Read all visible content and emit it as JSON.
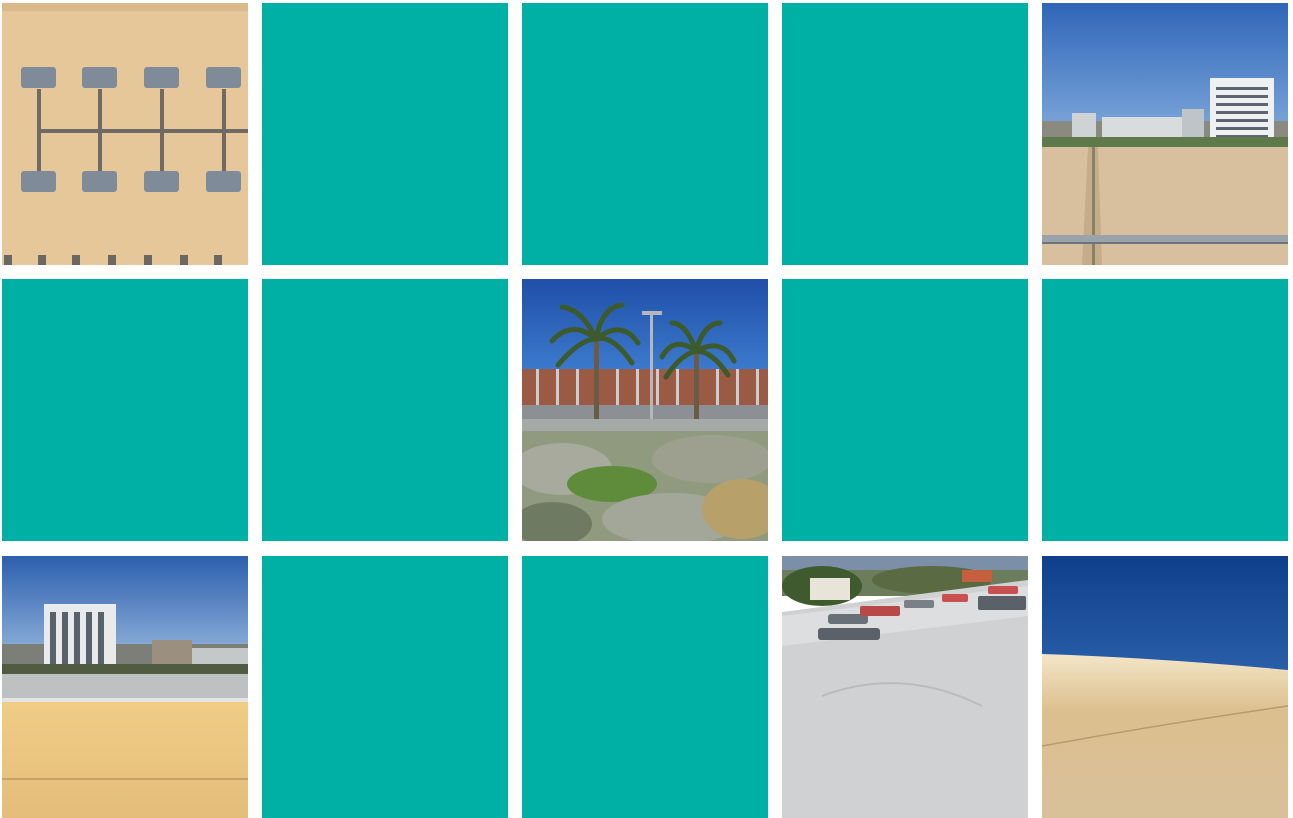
{
  "colors": {
    "placeholder": "#00b0a5",
    "background": "#ffffff"
  },
  "gallery": {
    "tiles": [
      {
        "kind": "photo",
        "scene": "roof-skylights-aerial"
      },
      {
        "kind": "placeholder"
      },
      {
        "kind": "placeholder"
      },
      {
        "kind": "placeholder"
      },
      {
        "kind": "photo",
        "scene": "roof-with-tower-block"
      },
      {
        "kind": "placeholder"
      },
      {
        "kind": "placeholder"
      },
      {
        "kind": "photo",
        "scene": "palm-trees-brick-building"
      },
      {
        "kind": "placeholder"
      },
      {
        "kind": "placeholder"
      },
      {
        "kind": "photo",
        "scene": "tower-block-sandy-roof"
      },
      {
        "kind": "placeholder"
      },
      {
        "kind": "placeholder"
      },
      {
        "kind": "photo",
        "scene": "white-roof-vents"
      },
      {
        "kind": "photo",
        "scene": "sand-horizon-sky"
      }
    ]
  }
}
